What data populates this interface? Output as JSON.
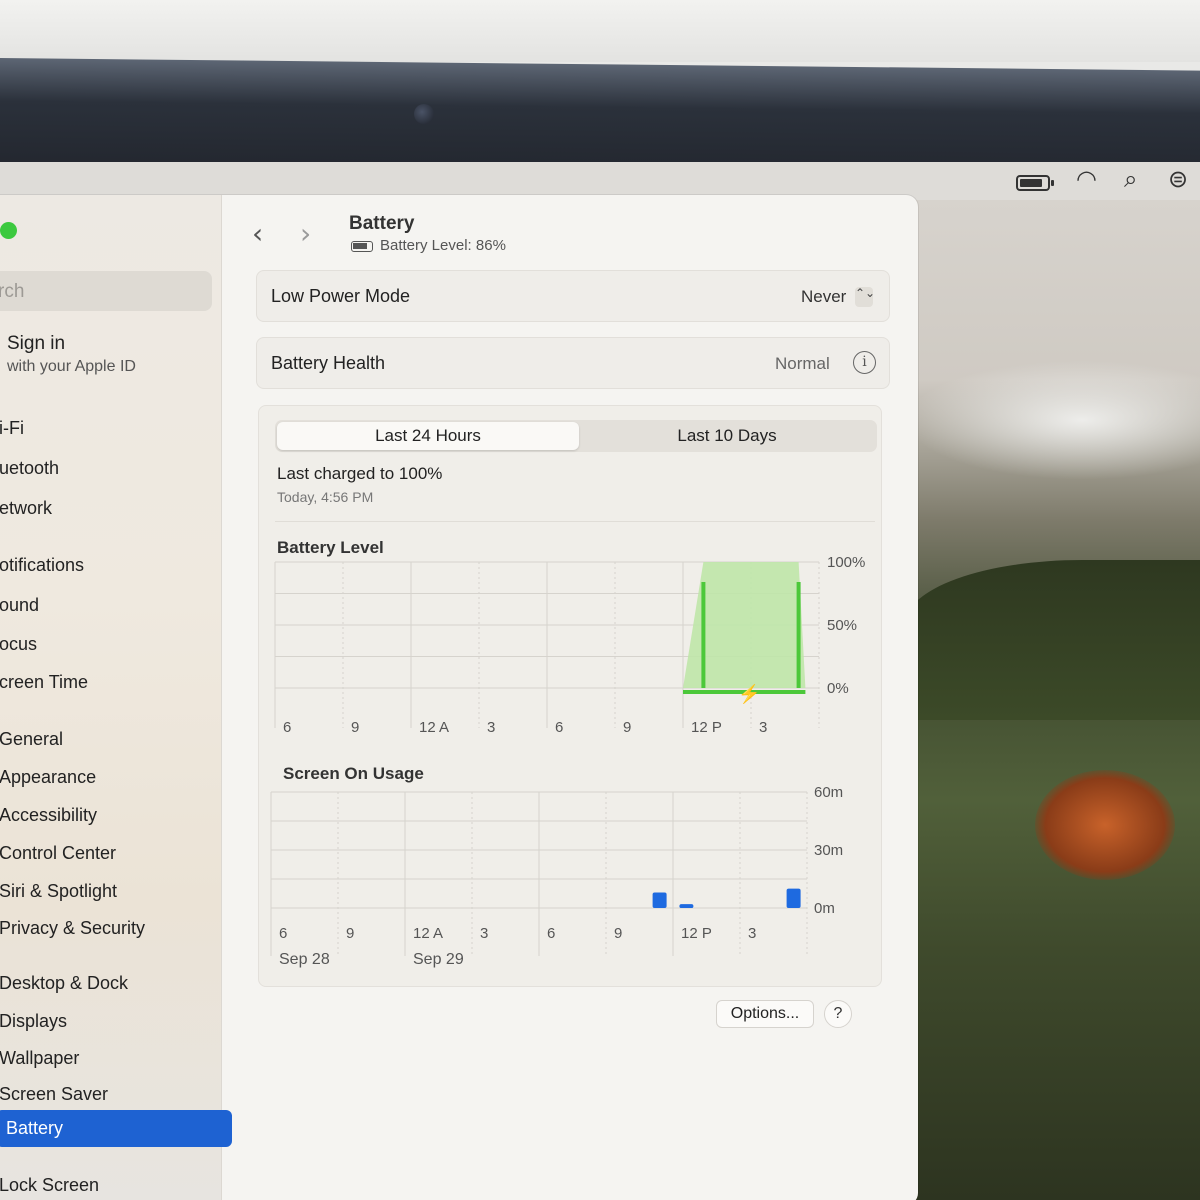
{
  "menubar": {
    "icons": [
      "battery-icon",
      "wifi-icon",
      "search-icon",
      "control-center-icon"
    ],
    "search_glyph": "⌕",
    "wifi_glyph": "◠",
    "cc_glyph": "⊜"
  },
  "sidebar": {
    "search_placeholder": "rch",
    "sign_in_title": "Sign in",
    "sign_in_sub": "with your Apple ID",
    "items": [
      {
        "label": "i-Fi"
      },
      {
        "label": "uetooth"
      },
      {
        "label": "etwork"
      },
      {
        "label": "otifications"
      },
      {
        "label": "ound"
      },
      {
        "label": "ocus"
      },
      {
        "label": "creen Time"
      },
      {
        "label": "General"
      },
      {
        "label": "Appearance"
      },
      {
        "label": "Accessibility"
      },
      {
        "label": "Control Center"
      },
      {
        "label": "Siri & Spotlight"
      },
      {
        "label": "Privacy & Security"
      },
      {
        "label": "Desktop & Dock"
      },
      {
        "label": "Displays"
      },
      {
        "label": "Wallpaper"
      },
      {
        "label": "Screen Saver"
      },
      {
        "label": "Battery",
        "active": true
      },
      {
        "label": "Lock Screen"
      }
    ]
  },
  "header": {
    "back": "‹",
    "forward": "›",
    "title": "Battery",
    "subtitle": "Battery Level: 86%"
  },
  "low_power": {
    "label": "Low Power Mode",
    "value": "Never",
    "stepper": "⌃⌄"
  },
  "battery_health": {
    "label": "Battery Health",
    "value": "Normal",
    "info": "i"
  },
  "tabs": {
    "active": "Last 24 Hours",
    "inactive": "Last 10 Days"
  },
  "last_charged": {
    "title": "Last charged to 100%",
    "time": "Today, 4:56 PM"
  },
  "chart_data": [
    {
      "type": "area",
      "title": "Battery Level",
      "x_ticks": [
        "6",
        "9",
        "12 A",
        "3",
        "6",
        "9",
        "12 P",
        "3"
      ],
      "y_ticks": [
        "100%",
        "50%",
        "0%"
      ],
      "ylim": [
        0,
        100
      ],
      "series": [
        {
          "values": [
            {
              "x": 6.0,
              "y": 0
            },
            {
              "x": 6.3,
              "y": 100
            },
            {
              "x": 7.7,
              "y": 100
            },
            {
              "x": 7.8,
              "y": 0
            }
          ]
        }
      ],
      "charging_indicator": "⚡",
      "colors": {
        "fill": "#bfe6a8",
        "line": "#4cc83a"
      }
    },
    {
      "type": "bar",
      "title": "Screen On Usage",
      "x_ticks": [
        "6",
        "9",
        "12 A",
        "3",
        "6",
        "9",
        "12 P",
        "3"
      ],
      "date_labels": [
        {
          "tick": 0,
          "label": "Sep 28"
        },
        {
          "tick": 2,
          "label": "Sep 29"
        }
      ],
      "y_ticks": [
        "60m",
        "30m",
        "0m"
      ],
      "ylim": [
        0,
        60
      ],
      "values": [
        {
          "x": 5.8,
          "y": 8
        },
        {
          "x": 6.2,
          "y": 2
        },
        {
          "x": 7.8,
          "y": 10
        }
      ],
      "colors": {
        "bar": "#1e6ae0"
      }
    }
  ],
  "footer": {
    "options": "Options...",
    "help": "?"
  }
}
